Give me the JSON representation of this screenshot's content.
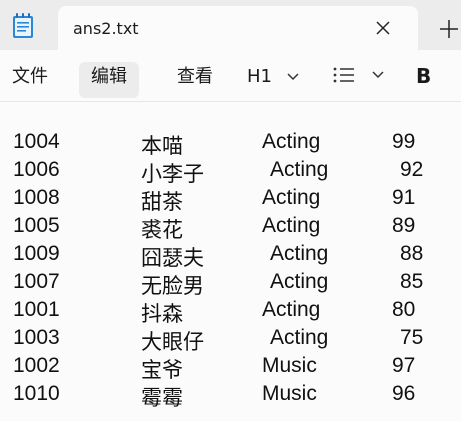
{
  "tab": {
    "title": "ans2.txt"
  },
  "menu": {
    "file": "文件",
    "edit": "编辑",
    "view": "查看",
    "heading": "H1"
  },
  "format": {
    "bold": "B"
  },
  "icons": {
    "app": "notepad-icon",
    "close": "close-icon",
    "new_tab": "plus-icon",
    "list": "list-icon"
  },
  "rows": [
    {
      "id": "1004",
      "name": "本喵",
      "category": "Acting",
      "score": "99",
      "shift": false
    },
    {
      "id": "1006",
      "name": "小李子",
      "category": "Acting",
      "score": "92",
      "shift": true
    },
    {
      "id": "1008",
      "name": "甜茶",
      "category": "Acting",
      "score": "91",
      "shift": false
    },
    {
      "id": "1005",
      "name": "裘花",
      "category": "Acting",
      "score": "89",
      "shift": false
    },
    {
      "id": "1009",
      "name": "囧瑟夫",
      "category": "Acting",
      "score": "88",
      "shift": true
    },
    {
      "id": "1007",
      "name": "无脸男",
      "category": "Acting",
      "score": "85",
      "shift": true
    },
    {
      "id": "1001",
      "name": "抖森",
      "category": "Acting",
      "score": "80",
      "shift": false
    },
    {
      "id": "1003",
      "name": "大眼仔",
      "category": "Acting",
      "score": "75",
      "shift": true
    },
    {
      "id": "1002",
      "name": "宝爷",
      "category": "Music",
      "score": "97",
      "shift": false
    },
    {
      "id": "1010",
      "name": "霉霉",
      "category": "Music",
      "score": "96",
      "shift": false
    }
  ]
}
